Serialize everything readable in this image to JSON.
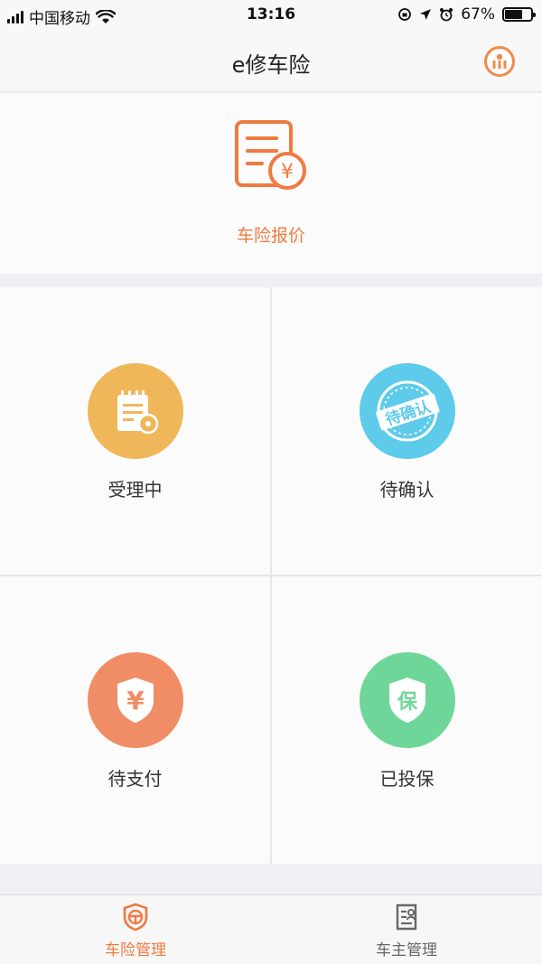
{
  "status_bar": {
    "carrier": "中国移动",
    "time": "13:16",
    "battery": "67%",
    "battery_level": 0.67
  },
  "nav": {
    "title": "e修车险",
    "action_icon": "chart-circle-icon"
  },
  "quote": {
    "label": "车险报价",
    "icon": "quote-document-yen-icon",
    "color": "#f07a3f"
  },
  "grid": [
    {
      "label": "受理中",
      "icon": "notepad-icon",
      "color": "#f0b75a"
    },
    {
      "label": "待确认",
      "icon": "pending-stamp-icon",
      "stamp_text": "待确认",
      "color": "#5ecbea"
    },
    {
      "label": "待支付",
      "icon": "yen-shield-icon",
      "color": "#f08d67"
    },
    {
      "label": "已投保",
      "icon": "insured-shield-icon",
      "shield_text": "保",
      "color": "#6fd69a"
    }
  ],
  "tabs": [
    {
      "label": "车险管理",
      "icon": "car-insurance-shield-icon",
      "active": true,
      "color": "#f07a3f"
    },
    {
      "label": "车主管理",
      "icon": "owner-card-icon",
      "active": false,
      "color": "#666666"
    }
  ]
}
